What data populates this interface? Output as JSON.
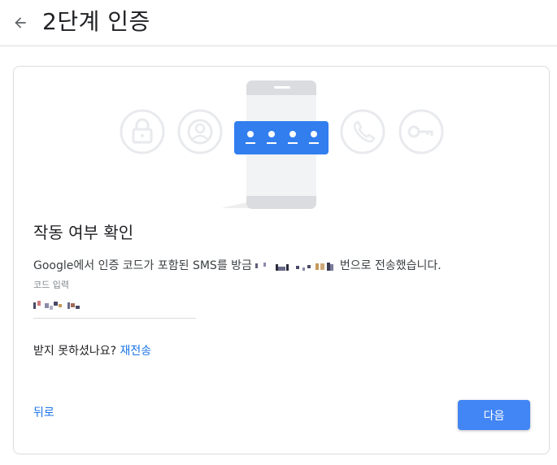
{
  "header": {
    "back_icon": "arrow-left-icon",
    "title": "2단계 인증"
  },
  "illustration": {
    "icons": [
      "lock-icon",
      "person-icon",
      "phone-handset-icon",
      "key-icon"
    ],
    "code_dots": 4
  },
  "card": {
    "title": "작동 여부 확인",
    "message_prefix": "Google에서 인증 코드가 포함된 SMS를 방금",
    "message_suffix": "번으로 전송했습니다.",
    "code_label": "코드 입력",
    "resend_prompt": "받지 못하셨나요?",
    "resend_link": "재전송",
    "back_link": "뒤로",
    "next_button": "다음"
  },
  "colors": {
    "accent": "#4285f4",
    "link": "#1a73e8",
    "border": "#dadce0",
    "icon_gray": "#e8eaed"
  }
}
